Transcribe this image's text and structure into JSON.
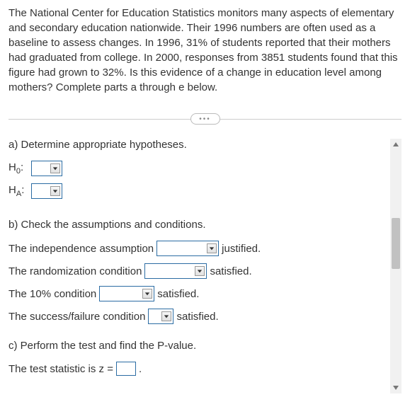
{
  "problem_text": "The National Center for Education Statistics monitors many aspects of elementary and secondary education nationwide. Their 1996 numbers are often used as a baseline to assess changes. In 1996, 31% of students reported that their mothers had graduated from college. In 2000, responses from 3851 students found that this figure had grown to 32%. Is this evidence of a change in education level among mothers? Complete parts a through e below.",
  "pill_label": "•••",
  "part_a": {
    "heading": "a) Determine appropriate hypotheses.",
    "h0_label": "H",
    "h0_sub": "0",
    "ha_label": "H",
    "ha_sub": "A"
  },
  "part_b": {
    "heading": "b) Check the assumptions and conditions.",
    "line1_pre": "The independence assumption",
    "line1_post": "justified.",
    "line2_pre": "The randomization condition",
    "line2_post": "satisfied.",
    "line3_pre": "The 10% condition",
    "line3_post": "satisfied.",
    "line4_pre": "The success/failure condition",
    "line4_post": "satisfied."
  },
  "part_c": {
    "heading": "c) Perform the test and find the P-value.",
    "stat_pre": "The test statistic is z =",
    "stat_post": "."
  }
}
